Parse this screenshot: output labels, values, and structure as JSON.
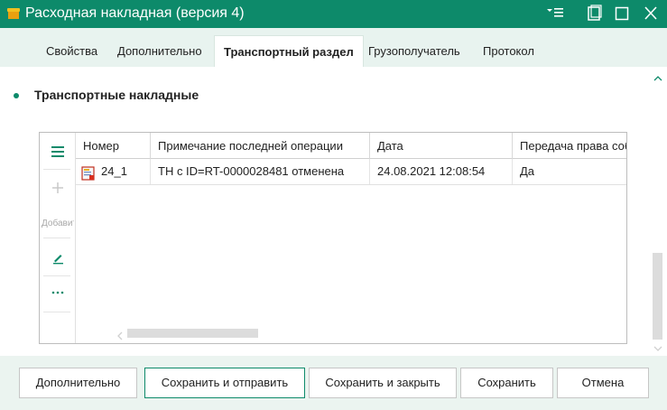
{
  "window": {
    "title": "Расходная накладная (версия 4)"
  },
  "tabs": [
    {
      "label": "Свойства",
      "active": false
    },
    {
      "label": "Дополнительно",
      "active": false
    },
    {
      "label": "Транспортный раздел",
      "active": true
    },
    {
      "label": "Грузополучатель",
      "active": false
    },
    {
      "label": "Протокол",
      "active": false
    }
  ],
  "section": {
    "title": "Транспортные накладные"
  },
  "grid": {
    "toolbar": {
      "add_label": "Добавить"
    },
    "columns": [
      "Номер",
      "Примечание последней операции",
      "Дата",
      "Передача права собственности"
    ],
    "rows": [
      {
        "number": "24_1",
        "note": "ТН с ID=RT-0000028481 отменена",
        "date": "24.08.2021 12:08:54",
        "transfer": "Да"
      }
    ]
  },
  "footer": {
    "additional_label": "Дополнительно",
    "save_send_label": "Сохранить и отправить",
    "save_close_label": "Сохранить и закрыть",
    "save_label": "Сохранить",
    "cancel_label": "Отмена"
  },
  "colors": {
    "accent": "#0d8a6a",
    "tabs_background": "#e8f3ef",
    "footer_background": "#ebf4f0"
  },
  "icons": {
    "app": "document-box-icon",
    "row": "document-status-icon",
    "grid_menu": "hamburger-icon",
    "grid_add": "plus-icon",
    "grid_edit": "pencil-icon",
    "grid_more": "ellipsis-icon"
  }
}
